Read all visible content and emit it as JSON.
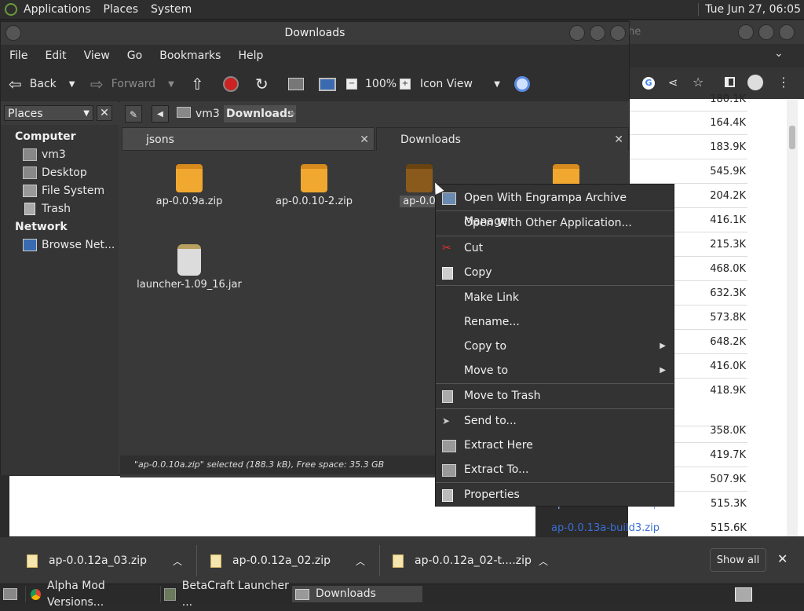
{
  "top_panel": {
    "menus": [
      "Applications",
      "Places",
      "System"
    ],
    "clock": "Tue Jun 27, 06:05"
  },
  "browser_bg": {
    "tab_fragment": "he",
    "sizes": [
      "180.1K",
      "164.4K",
      "183.9K",
      "545.9K",
      "204.2K",
      "416.1K",
      "215.3K",
      "468.0K",
      "632.3K",
      "573.8K",
      "648.2K",
      "416.0K",
      "418.9K",
      "358.0K",
      "419.7K",
      "507.9K",
      "515.3K",
      "515.6K"
    ],
    "links": [
      "ap-0.0.13a-build2.zip",
      "ap-0.0.13a-build3.zip"
    ]
  },
  "file_manager": {
    "title": "Downloads",
    "menu": [
      "File",
      "Edit",
      "View",
      "Go",
      "Bookmarks",
      "Help"
    ],
    "toolbar": {
      "back": "Back",
      "forward": "Forward",
      "zoom": "100%",
      "view_mode": "Icon View"
    },
    "sidebar": {
      "selector": "Places",
      "computer_heading": "Computer",
      "computer_items": [
        "vm3",
        "Desktop",
        "File System",
        "Trash"
      ],
      "network_heading": "Network",
      "network_items": [
        "Browse Net..."
      ]
    },
    "path": [
      "vm3",
      "Downloads"
    ],
    "tabs": [
      {
        "label": "jsons"
      },
      {
        "label": "Downloads"
      }
    ],
    "files": [
      {
        "name": "ap-0.0.9a.zip"
      },
      {
        "name": "ap-0.0.10-2.zip"
      },
      {
        "name": "ap-0.0"
      },
      {
        "name": ""
      },
      {
        "name": "launcher-1.09_16.jar"
      }
    ],
    "status": "\"ap-0.0.10a.zip\" selected (188.3 kB), Free space: 35.3 GB"
  },
  "context_menu": {
    "items": [
      "Open With Engrampa Archive Manager",
      "Open With Other Application...",
      "Cut",
      "Copy",
      "Make Link",
      "Rename...",
      "Copy to",
      "Move to",
      "Move to Trash",
      "Send to...",
      "Extract Here",
      "Extract To...",
      "Properties"
    ]
  },
  "downloads_bar": {
    "items": [
      "ap-0.0.12a_03.zip",
      "ap-0.0.12a_02.zip",
      "ap-0.0.12a_02-t....zip"
    ],
    "show_all": "Show all"
  },
  "taskbar": {
    "tasks": [
      "Alpha Mod Versions...",
      "BetaCraft Launcher ...",
      "Downloads"
    ]
  },
  "colors": {
    "folder_orange": "#f0a830",
    "link_blue": "#3b6fd6",
    "record_red": "#cc2222"
  }
}
